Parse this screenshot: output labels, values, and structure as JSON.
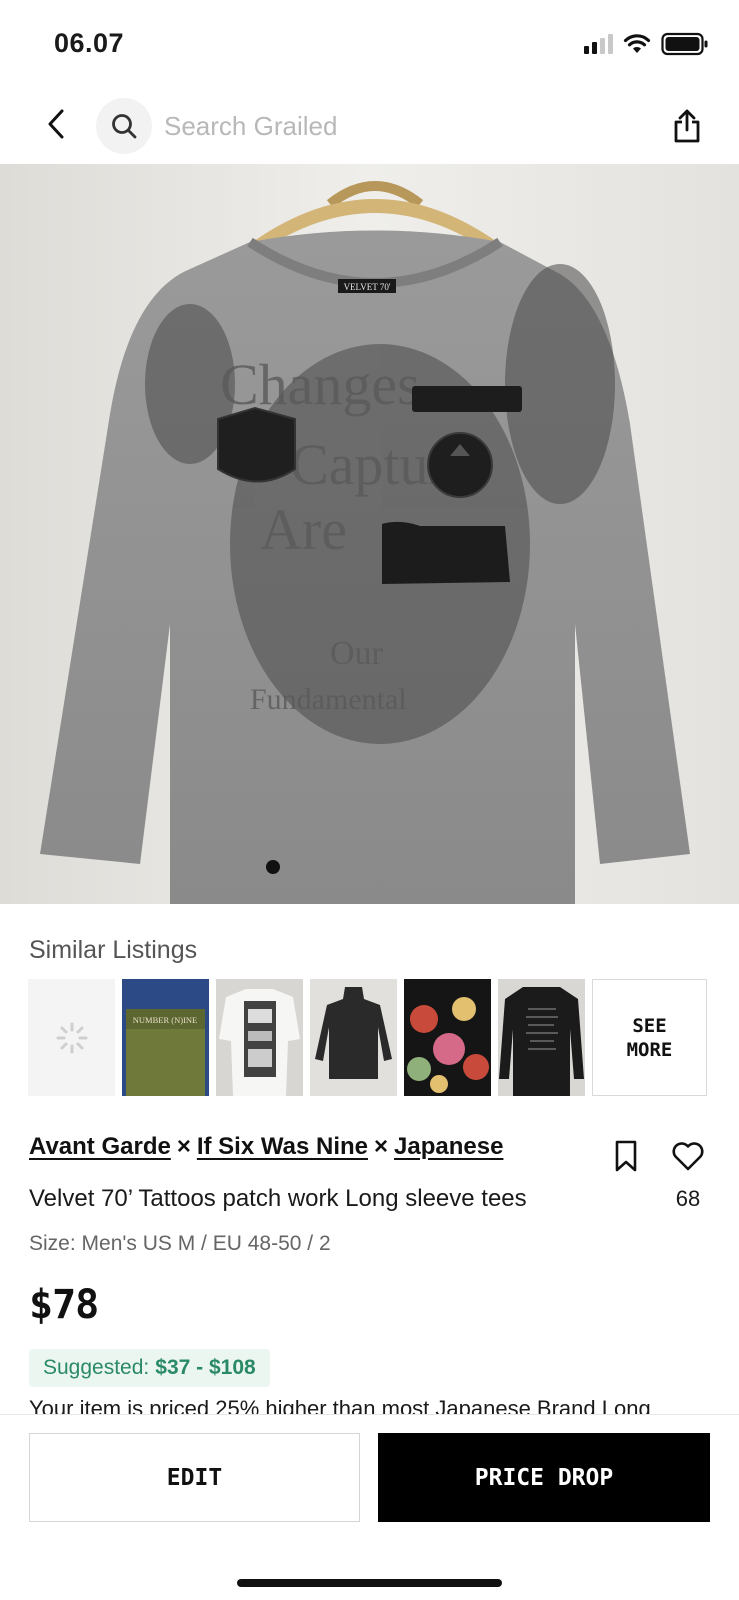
{
  "status_bar": {
    "time": "06.07"
  },
  "nav": {
    "search_placeholder": "Search Grailed"
  },
  "hero": {
    "label_text": "VELVET 70'",
    "print_words": [
      "Changes",
      "Capture",
      "Are",
      "Our",
      "Fundamental"
    ]
  },
  "similar": {
    "title": "Similar Listings",
    "see_more": "SEE\nMORE",
    "thumb_label": "NUMBER (N)INE"
  },
  "listing": {
    "designers": [
      "Avant Garde",
      "If Six Was Nine",
      "Japanese"
    ],
    "separator": "×",
    "title": "Velvet 70’ Tattoos patch work Long sleeve tees",
    "size": "Size: Men's US M / EU 48-50 / 2",
    "likes": "68",
    "price": "$78",
    "suggested_label": "Suggested:",
    "suggested_range": "$37 - $108",
    "pricing_note": "Your item is priced 25% higher than most Japanese Brand Long"
  },
  "actions": {
    "edit": "EDIT",
    "price_drop": "PRICE DROP"
  },
  "colors": {
    "accent_green": "#2a8a66",
    "suggested_bg": "#ebf6f1",
    "primary_black": "#000000"
  }
}
